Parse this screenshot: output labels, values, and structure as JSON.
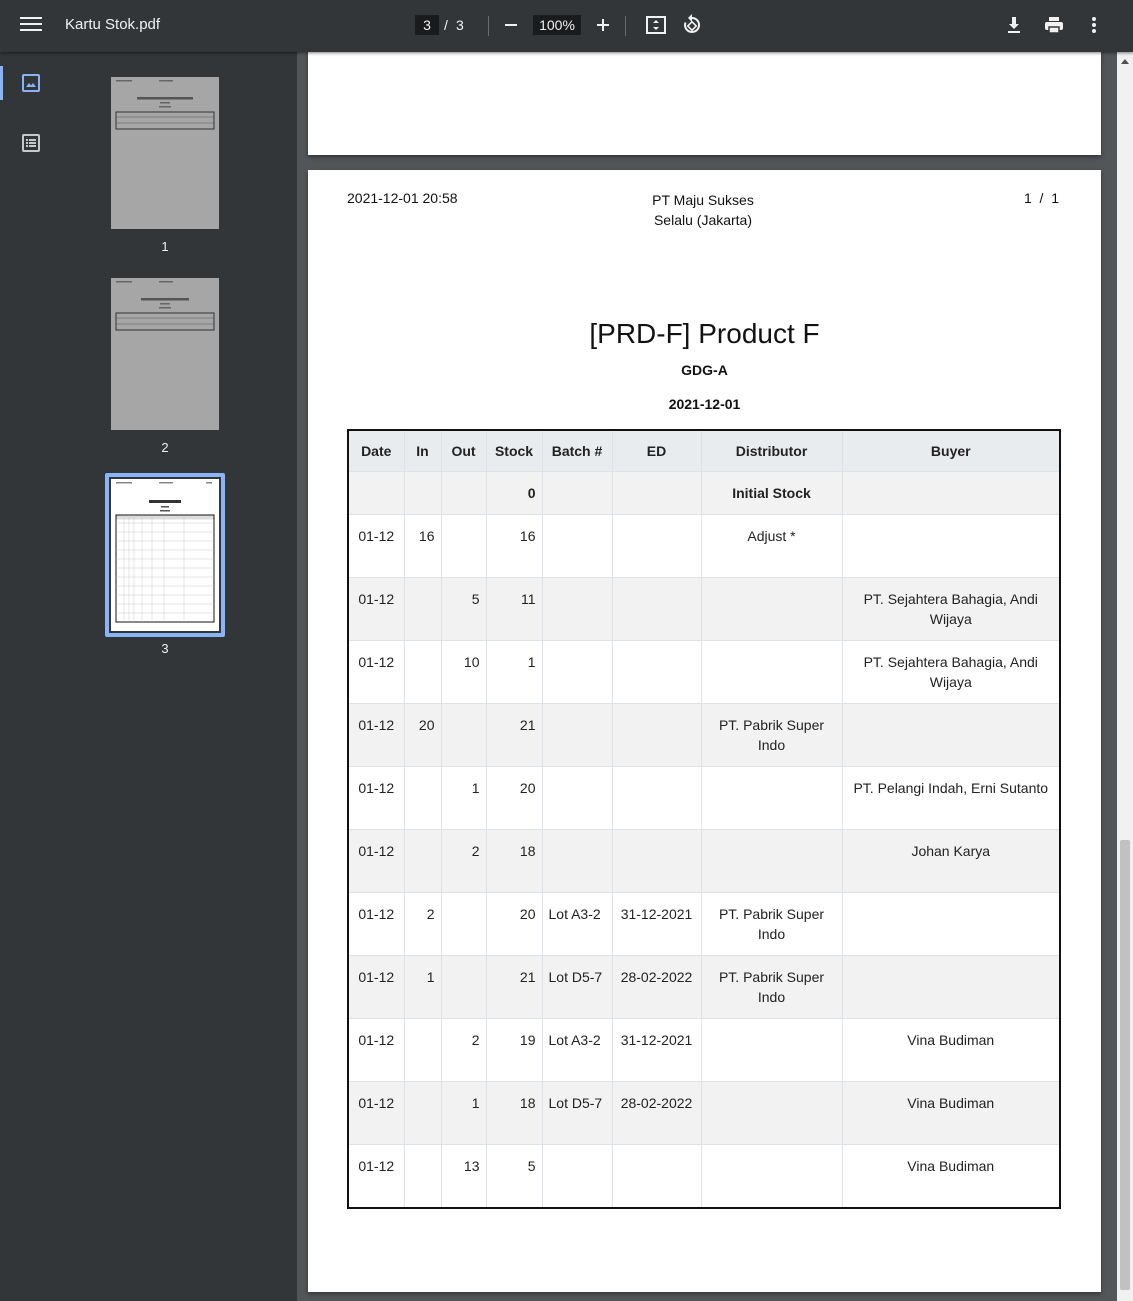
{
  "toolbar": {
    "title": "Kartu Stok.pdf",
    "current_page": "3",
    "separator": "/",
    "total_pages": "3",
    "zoom": "100%"
  },
  "thumbnails": [
    {
      "label": "1"
    },
    {
      "label": "2"
    },
    {
      "label": "3"
    }
  ],
  "page": {
    "printed": "2021-12-01 20:58",
    "company_line1": "PT Maju Sukses",
    "company_line2": "Selalu (Jakarta)",
    "page_count": "1  /  1",
    "title": "[PRD-F] Product F",
    "warehouse": "GDG-A",
    "date": "2021-12-01"
  },
  "table": {
    "headers": [
      "Date",
      "In",
      "Out",
      "Stock",
      "Batch #",
      "ED",
      "Distributor",
      "Buyer"
    ],
    "initial_row": {
      "stock": "0",
      "label": "Initial Stock"
    },
    "rows": [
      [
        "01-12",
        "16",
        "",
        "16",
        "",
        "",
        "Adjust *",
        ""
      ],
      [
        "01-12",
        "",
        "5",
        "11",
        "",
        "",
        "",
        "PT. Sejahtera Bahagia, Andi Wijaya"
      ],
      [
        "01-12",
        "",
        "10",
        "1",
        "",
        "",
        "",
        "PT. Sejahtera Bahagia, Andi Wijaya"
      ],
      [
        "01-12",
        "20",
        "",
        "21",
        "",
        "",
        "PT. Pabrik Super Indo",
        ""
      ],
      [
        "01-12",
        "",
        "1",
        "20",
        "",
        "",
        "",
        "PT. Pelangi Indah, Erni Sutanto"
      ],
      [
        "01-12",
        "",
        "2",
        "18",
        "",
        "",
        "",
        "Johan Karya"
      ],
      [
        "01-12",
        "2",
        "",
        "20",
        "Lot A3-2",
        "31-12-2021",
        "PT. Pabrik Super Indo",
        ""
      ],
      [
        "01-12",
        "1",
        "",
        "21",
        "Lot D5-7",
        "28-02-2022",
        "PT. Pabrik Super Indo",
        ""
      ],
      [
        "01-12",
        "",
        "2",
        "19",
        "Lot A3-2",
        "31-12-2021",
        "",
        "Vina Budiman"
      ],
      [
        "01-12",
        "",
        "1",
        "18",
        "Lot D5-7",
        "28-02-2022",
        "",
        "Vina Budiman"
      ],
      [
        "01-12",
        "",
        "13",
        "5",
        "",
        "",
        "",
        "Vina Budiman"
      ]
    ]
  },
  "icons": {
    "menu": "menu-icon",
    "zoom_out": "minus-icon",
    "zoom_in": "plus-icon",
    "fit": "fit-page-icon",
    "rotate": "rotate-icon",
    "download": "download-icon",
    "print": "print-icon",
    "more": "more-vert-icon",
    "thumbnails_view": "image-icon",
    "outline_view": "list-icon"
  },
  "colors": {
    "toolbar_bg": "#323639",
    "viewer_bg": "#525659",
    "selection": "#8ab4f8",
    "header_bg": "#e9ecef",
    "stripe_bg": "#f2f2f2"
  }
}
